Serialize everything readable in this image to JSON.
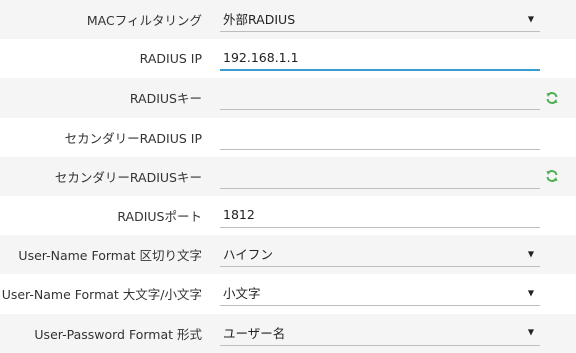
{
  "form": {
    "mac_filtering": {
      "label": "MACフィルタリング",
      "value": "外部RADIUS"
    },
    "radius_ip": {
      "label": "RADIUS IP",
      "value": "192.168.1.1"
    },
    "radius_key": {
      "label": "RADIUSキー",
      "value": ""
    },
    "secondary_radius_ip": {
      "label": "セカンダリーRADIUS IP",
      "value": ""
    },
    "secondary_radius_key": {
      "label": "セカンダリーRADIUSキー",
      "value": ""
    },
    "radius_port": {
      "label": "RADIUSポート",
      "value": "1812"
    },
    "username_format_separator": {
      "label": "User-Name Format 区切り文字",
      "value": "ハイフン"
    },
    "username_format_case": {
      "label": "User-Name Format 大文字/小文字",
      "value": "小文字"
    },
    "password_format": {
      "label": "User-Password Format 形式",
      "value": "ユーザー名"
    }
  },
  "icons": {
    "dropdown": "triangle-down-icon",
    "refresh": "refresh-icon"
  },
  "colors": {
    "focus_underline": "#3b9bd0",
    "refresh_icon": "#4caf50",
    "alt_row_bg": "#f5f5f5"
  }
}
